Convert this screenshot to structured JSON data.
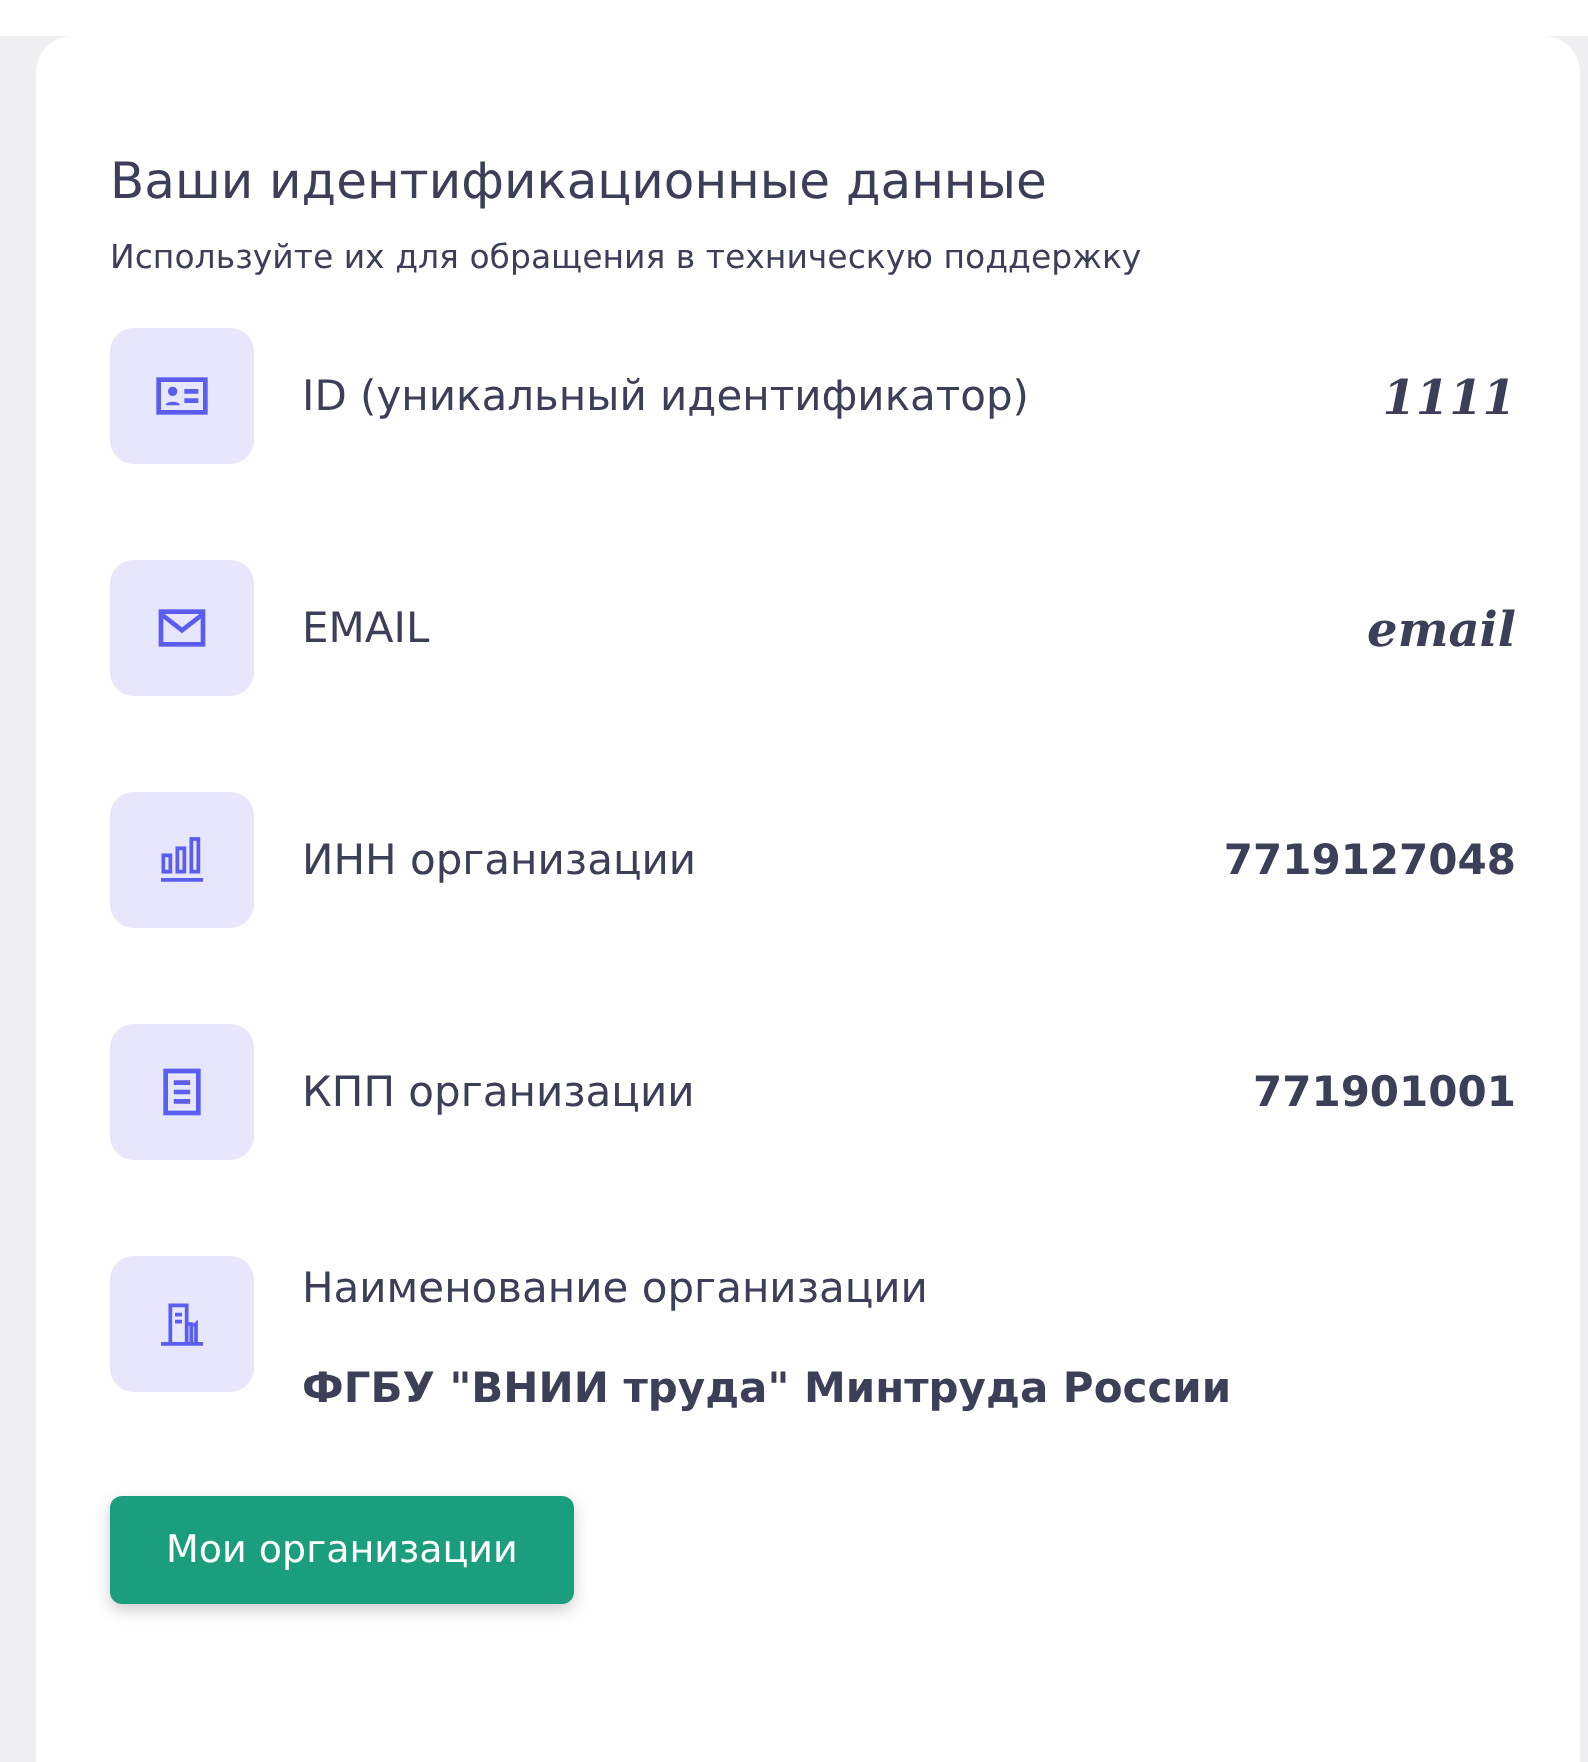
{
  "card": {
    "title": "Ваши идентификационные данные",
    "subtitle": "Используйте их для обращения в техническую поддержку",
    "rows": [
      {
        "kind": "inline",
        "label": "ID (уникальный идентификатор)",
        "value": "1111",
        "italic": true
      },
      {
        "kind": "inline",
        "label": "EMAIL",
        "value": "email",
        "italic": true
      },
      {
        "kind": "inline",
        "label": "ИНН организации",
        "value": "7719127048",
        "italic": false
      },
      {
        "kind": "inline",
        "label": "КПП организации",
        "value": "771901001",
        "italic": false
      },
      {
        "kind": "stacked",
        "label": "Наименование организации",
        "value": "ФГБУ \"ВНИИ труда\" Минтруда России",
        "italic": false
      }
    ],
    "button": "Мои организации"
  }
}
